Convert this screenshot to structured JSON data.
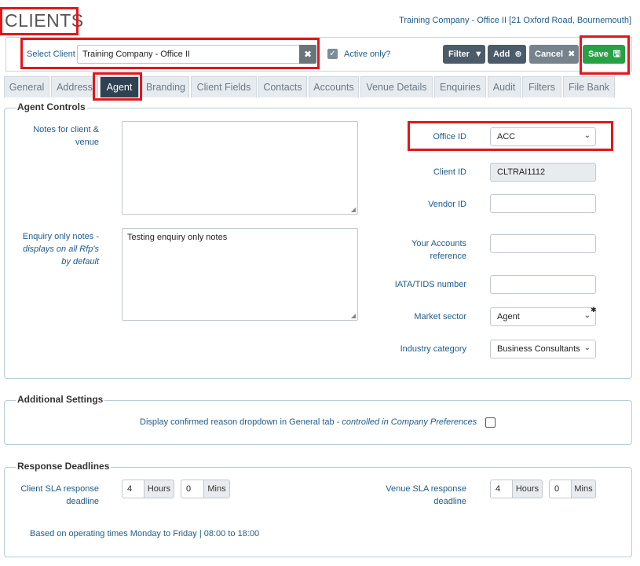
{
  "header": {
    "title": "CLIENTS",
    "company_info": "Training Company - Office II [21 Oxford Road, Bournemouth]"
  },
  "toolbar": {
    "select_client_label": "Select Client",
    "select_client_value": "Training Company - Office II",
    "active_only_label": "Active only?",
    "active_only_checked": true,
    "filter_label": "Filter",
    "add_label": "Add",
    "cancel_label": "Cancel",
    "save_label": "Save"
  },
  "tabs": [
    {
      "label": "General"
    },
    {
      "label": "Address"
    },
    {
      "label": "Agent",
      "active": true
    },
    {
      "label": "Branding"
    },
    {
      "label": "Client Fields"
    },
    {
      "label": "Contacts"
    },
    {
      "label": "Accounts"
    },
    {
      "label": "Venue Details"
    },
    {
      "label": "Enquiries"
    },
    {
      "label": "Audit"
    },
    {
      "label": "Filters"
    },
    {
      "label": "File Bank"
    }
  ],
  "agent_controls": {
    "legend": "Agent Controls",
    "notes_label_1": "Notes for client &",
    "notes_label_2": "venue",
    "notes_value": "",
    "enquiry_label_1": "Enquiry only notes -",
    "enquiry_label_2": "displays on all Rfp's",
    "enquiry_label_3": "by default",
    "enquiry_value": "Testing enquiry only notes",
    "office_id_label": "Office ID",
    "office_id_value": "ACC",
    "client_id_label": "Client ID",
    "client_id_value": "CLTRAI1112",
    "vendor_id_label": "Vendor ID",
    "vendor_id_value": "",
    "accounts_ref_label_1": "Your Accounts",
    "accounts_ref_label_2": "reference",
    "accounts_ref_value": "",
    "iata_label": "IATA/TIDS number",
    "iata_value": "",
    "market_sector_label": "Market sector",
    "market_sector_value": "Agent",
    "industry_category_label": "Industry category",
    "industry_category_value": "Business Consultants"
  },
  "additional_settings": {
    "legend": "Additional Settings",
    "confirmed_reason_label": "Display confirmed reason dropdown in General tab -",
    "confirmed_reason_note": "controlled in Company Preferences",
    "confirmed_reason_checked": false
  },
  "response_deadlines": {
    "legend": "Response Deadlines",
    "client_sla_label_1": "Client SLA response",
    "client_sla_label_2": "deadline",
    "client_hours": "4",
    "client_mins": "0",
    "venue_sla_label_1": "Venue SLA response",
    "venue_sla_label_2": "deadline",
    "venue_hours": "4",
    "venue_mins": "0",
    "hours_unit": "Hours",
    "mins_unit": "Mins",
    "operating_times": "Based on operating times Monday to Friday | 08:00 to 18:00"
  },
  "colors": {
    "highlight": "#e0171b",
    "active_tab": "#2f4253",
    "save": "#27a046",
    "link_text": "#1f5b8a"
  }
}
